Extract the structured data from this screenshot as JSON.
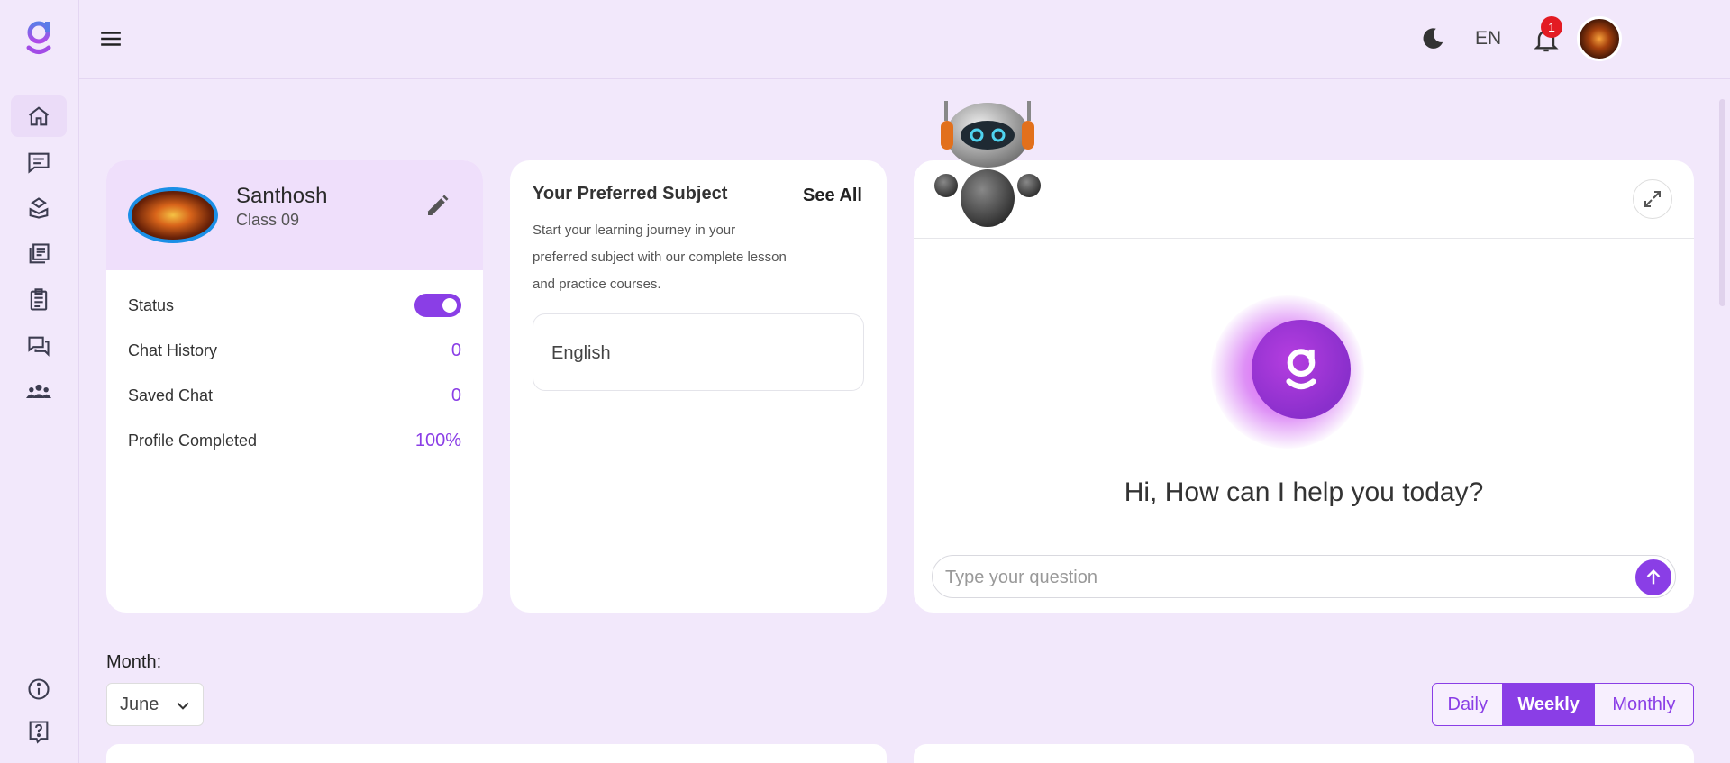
{
  "brand": {
    "accent": "#8a3ee6",
    "background": "#f2e8fb"
  },
  "sidebar": {
    "items": [
      {
        "icon": "home-icon",
        "label": "Home"
      },
      {
        "icon": "chat-icon",
        "label": "Chat"
      },
      {
        "icon": "learn-icon",
        "label": "Learn"
      },
      {
        "icon": "library-icon",
        "label": "Library"
      },
      {
        "icon": "clipboard-icon",
        "label": "Assignments"
      },
      {
        "icon": "forum-icon",
        "label": "Forum"
      },
      {
        "icon": "community-icon",
        "label": "Community"
      }
    ],
    "bottom_items": [
      {
        "icon": "info-icon"
      },
      {
        "icon": "help-icon"
      }
    ]
  },
  "header": {
    "language": "EN",
    "notification_count": "1"
  },
  "profile": {
    "name": "Santhosh",
    "class": "Class 09",
    "stats": [
      {
        "label": "Status",
        "value": "on"
      },
      {
        "label": "Chat History",
        "value": "0"
      },
      {
        "label": "Saved Chat",
        "value": "0"
      },
      {
        "label": "Profile Completed",
        "value": "100%"
      }
    ]
  },
  "subjects": {
    "title": "Your Preferred Subject",
    "see_all": "See All",
    "description": "Start your learning journey in your preferred subject with our complete lesson and practice courses.",
    "items": [
      "English"
    ]
  },
  "chat": {
    "greeting": "Hi, How can I help you today?",
    "placeholder": "Type your question"
  },
  "filters": {
    "month_label": "Month:",
    "month_value": "June",
    "periods": [
      "Daily",
      "Weekly",
      "Monthly"
    ],
    "active_period": "Weekly"
  }
}
